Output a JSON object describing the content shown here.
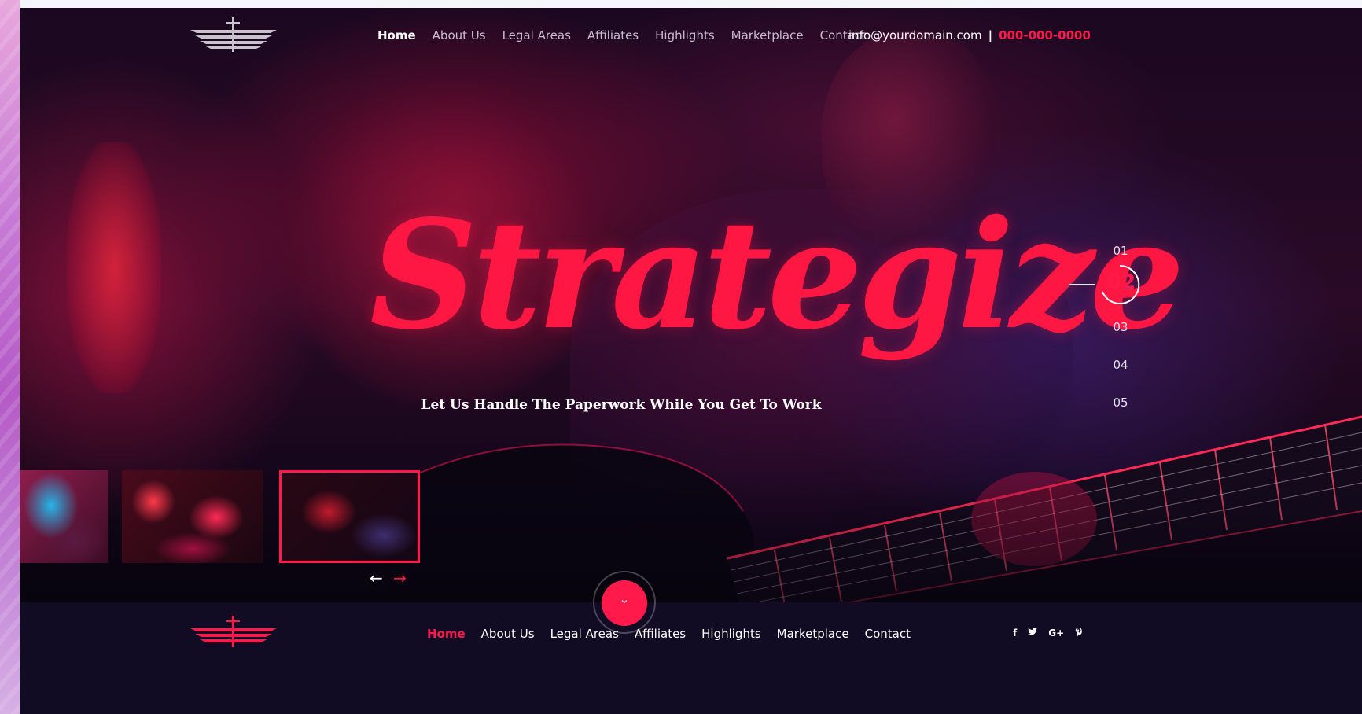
{
  "header": {
    "nav": [
      "Home",
      "About Us",
      "Legal Areas",
      "Affiliates",
      "Highlights",
      "Marketplace",
      "Contact"
    ],
    "active_nav": "Home",
    "email": "info@yourdomain.com",
    "separator": "|",
    "phone": "000-000-0000"
  },
  "hero": {
    "headline": "Strategize",
    "subtitle": "Let Us Handle The Paperwork While You Get To Work"
  },
  "slides": {
    "numbers": [
      "01",
      "02",
      "03",
      "04",
      "05"
    ],
    "active": "02"
  },
  "thumbnails": {
    "count": 3,
    "active_index": 3,
    "prev_icon": "arrow-left-icon",
    "next_icon": "arrow-right-icon"
  },
  "scroll": {
    "icon": "chevron-down-icon",
    "glyph": "⌄"
  },
  "footer": {
    "nav": [
      "Home",
      "About Us",
      "Legal Areas",
      "Affiliates",
      "Highlights",
      "Marketplace",
      "Contact"
    ],
    "active_nav": "Home",
    "social": [
      {
        "icon": "facebook-icon",
        "glyph": "f"
      },
      {
        "icon": "twitter-icon",
        "glyph": "🐦"
      },
      {
        "icon": "google-plus-icon",
        "glyph": "G+"
      },
      {
        "icon": "pinterest-icon",
        "glyph": "℗"
      }
    ]
  },
  "colors": {
    "accent": "#ff1a4b",
    "headline": "#ff1744",
    "background": "#1b0820",
    "footer_bg": "#120b24",
    "nav_text": "#c9bcd0"
  }
}
